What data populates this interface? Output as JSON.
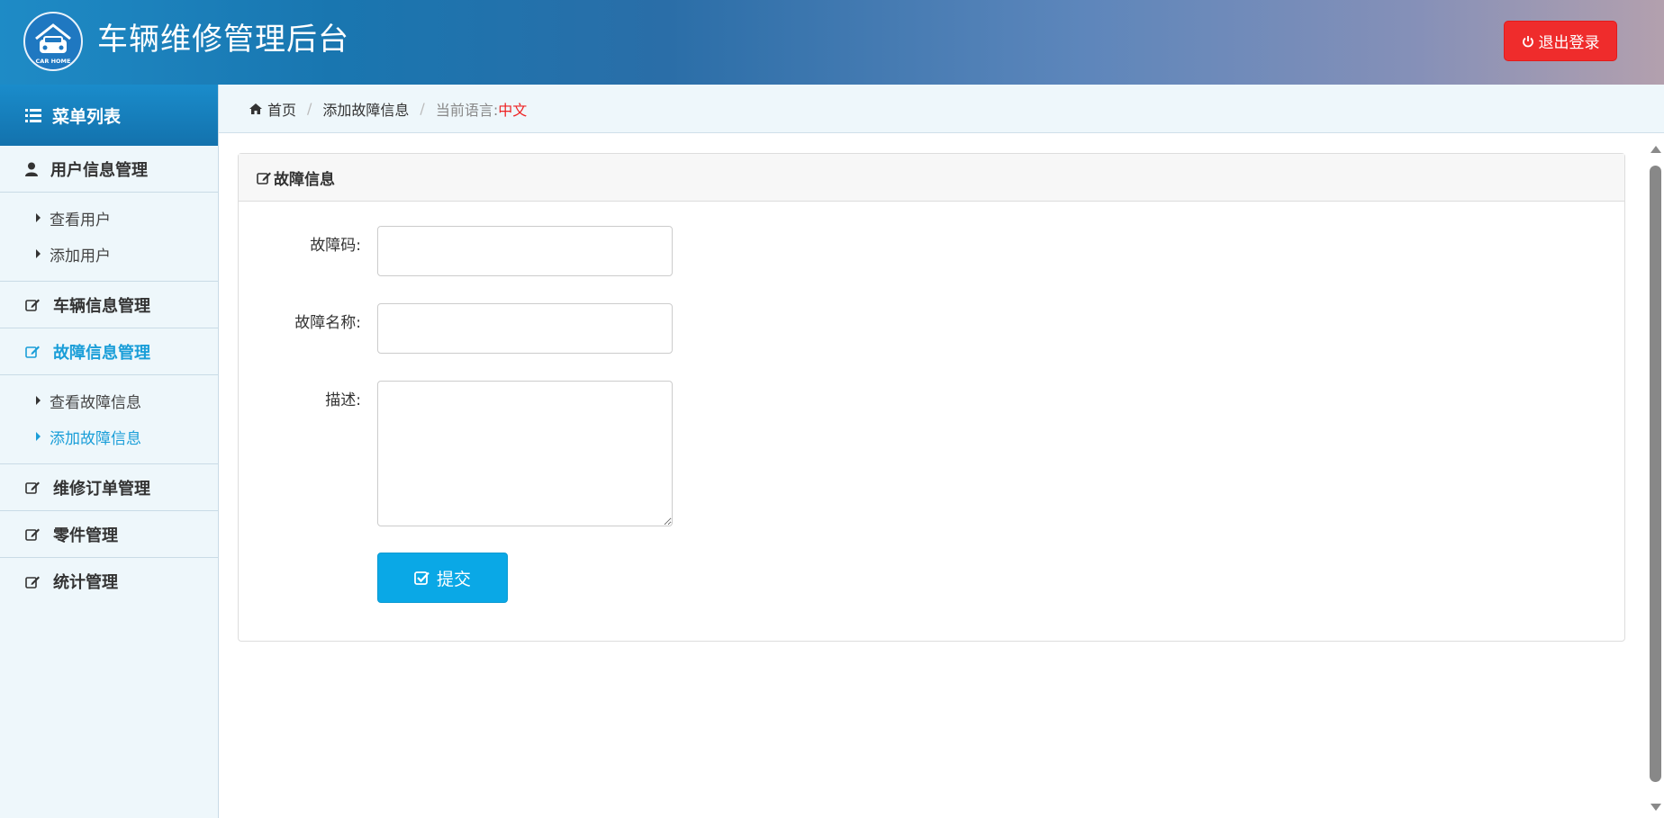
{
  "header": {
    "logo_text": "CAR HOME",
    "title": "车辆维修管理后台",
    "logout_label": "退出登录"
  },
  "sidebar": {
    "menu_title": "菜单列表",
    "groups": [
      {
        "label": "用户信息管理",
        "items": [
          {
            "label": "查看用户"
          },
          {
            "label": "添加用户"
          }
        ]
      },
      {
        "label": "车辆信息管理"
      },
      {
        "label": "故障信息管理",
        "active": true,
        "items": [
          {
            "label": "查看故障信息"
          },
          {
            "label": "添加故障信息",
            "active": true
          }
        ]
      },
      {
        "label": "维修订单管理"
      },
      {
        "label": "零件管理"
      },
      {
        "label": "统计管理"
      }
    ]
  },
  "breadcrumb": {
    "home": "首页",
    "current": "添加故障信息",
    "language_label": "当前语言:",
    "language_value": "中文"
  },
  "panel": {
    "title": "故障信息",
    "fields": {
      "code_label": "故障码:",
      "code_value": "",
      "name_label": "故障名称:",
      "name_value": "",
      "desc_label": "描述:",
      "desc_value": ""
    },
    "submit_label": "提交"
  },
  "colors": {
    "accent": "#1a9ed8",
    "logout": "#ef2c2c",
    "submit": "#0aa8e6",
    "language": "#ee2222"
  }
}
